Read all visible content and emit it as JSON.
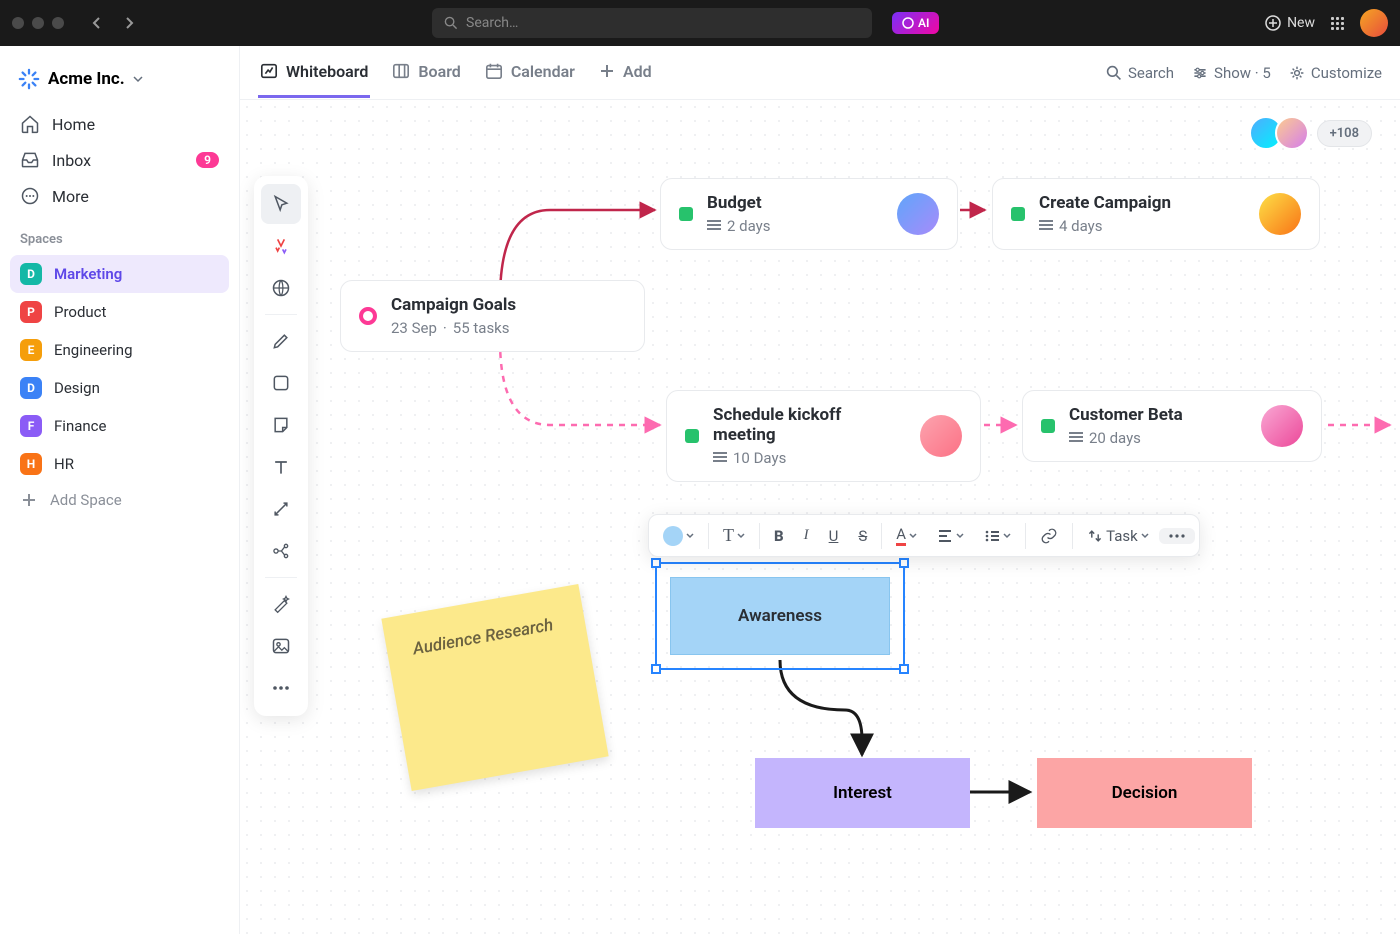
{
  "titlebar": {
    "search_placeholder": "Search…",
    "ai_label": "AI",
    "new_label": "New"
  },
  "workspace": {
    "name": "Acme Inc."
  },
  "sidebar": {
    "items": [
      {
        "label": "Home"
      },
      {
        "label": "Inbox",
        "badge": "9"
      },
      {
        "label": "More"
      }
    ],
    "spaces_label": "Spaces",
    "spaces": [
      {
        "letter": "D",
        "color": "#14b8a6",
        "label": "Marketing",
        "active": true
      },
      {
        "letter": "P",
        "color": "#ef4444",
        "label": "Product"
      },
      {
        "letter": "E",
        "color": "#f59e0b",
        "label": "Engineering"
      },
      {
        "letter": "D",
        "color": "#3b82f6",
        "label": "Design"
      },
      {
        "letter": "F",
        "color": "#8b5cf6",
        "label": "Finance"
      },
      {
        "letter": "H",
        "color": "#f97316",
        "label": "HR"
      }
    ],
    "add_space": "Add Space"
  },
  "view_tabs": {
    "tabs": [
      {
        "label": "Whiteboard",
        "active": true
      },
      {
        "label": "Board"
      },
      {
        "label": "Calendar"
      },
      {
        "label": "Add"
      }
    ],
    "search": "Search",
    "show": "Show · 5",
    "customize": "Customize"
  },
  "avatars_more": "+108",
  "cards": {
    "goals": {
      "title": "Campaign Goals",
      "date": "23 Sep",
      "tasks": "55 tasks"
    },
    "budget": {
      "title": "Budget",
      "duration": "2 days"
    },
    "campaign": {
      "title": "Create Campaign",
      "duration": "4 days"
    },
    "kickoff": {
      "title": "Schedule kickoff meeting",
      "duration": "10 Days"
    },
    "beta": {
      "title": "Customer Beta",
      "duration": "20 days"
    }
  },
  "sticky": {
    "text": "Audience Research"
  },
  "funnel": {
    "awareness": "Awareness",
    "interest": "Interest",
    "decision": "Decision"
  },
  "fmt": {
    "task": "Task"
  }
}
